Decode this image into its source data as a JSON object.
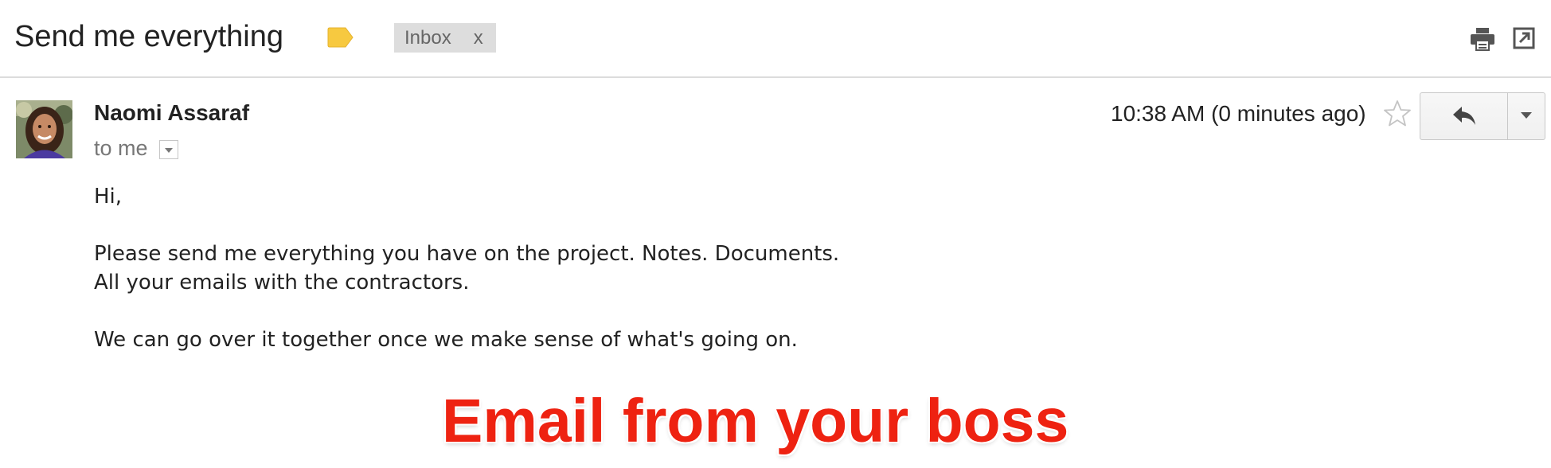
{
  "email": {
    "subject": "Send me everything",
    "label_chip": {
      "label": "Inbox",
      "close": "x"
    },
    "sender": {
      "name": "Naomi Assaraf"
    },
    "recipient": "to me",
    "timestamp": "10:38 AM (0 minutes ago)",
    "body": {
      "greeting": "Hi,",
      "line1": "Please send me everything you have on the project. Notes. Documents.",
      "line2": "All your emails with the contractors.",
      "line3": "We can go over it together once we make sense of what's going on."
    }
  },
  "caption": "Email from your boss",
  "icons": {
    "label_tag": "label-icon",
    "print": "print-icon",
    "new_window": "new-window-icon",
    "star": "star-icon",
    "reply": "reply-icon",
    "more": "chevron-down-icon"
  },
  "colors": {
    "label_tag": "#f7c940",
    "chip_bg": "#dddddd",
    "caption": "#ee2211",
    "divider": "#dcdcdc"
  }
}
